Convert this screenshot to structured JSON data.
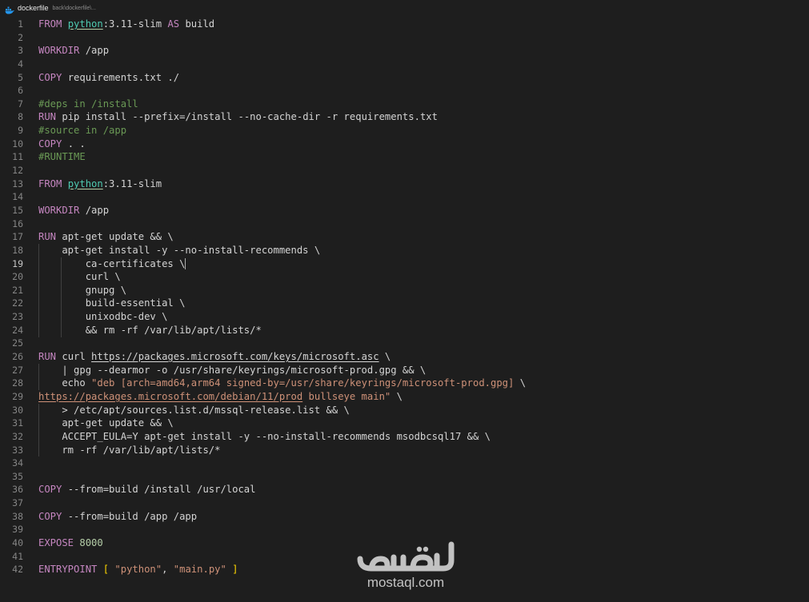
{
  "tab": {
    "title": "dockerfile",
    "path": "back\\dockerfile\\...",
    "icon": "docker-whale-icon"
  },
  "editor": {
    "active_line": 19,
    "lines": [
      {
        "n": "1",
        "tokens": [
          [
            "k",
            "FROM "
          ],
          [
            "img",
            "python"
          ],
          [
            "t",
            ":3.11-slim "
          ],
          [
            "k",
            "AS "
          ],
          [
            "t",
            "build"
          ]
        ]
      },
      {
        "n": "2",
        "tokens": []
      },
      {
        "n": "3",
        "tokens": [
          [
            "k",
            "WORKDIR "
          ],
          [
            "t",
            "/app"
          ]
        ]
      },
      {
        "n": "4",
        "tokens": []
      },
      {
        "n": "5",
        "tokens": [
          [
            "k",
            "COPY "
          ],
          [
            "t",
            "requirements.txt ./"
          ]
        ]
      },
      {
        "n": "6",
        "tokens": []
      },
      {
        "n": "7",
        "tokens": [
          [
            "c",
            "#deps in /install"
          ]
        ]
      },
      {
        "n": "8",
        "tokens": [
          [
            "k",
            "RUN "
          ],
          [
            "t",
            "pip install --prefix=/install --no-cache-dir -r requirements.txt"
          ]
        ]
      },
      {
        "n": "9",
        "tokens": [
          [
            "c",
            "#source in /app"
          ]
        ]
      },
      {
        "n": "10",
        "tokens": [
          [
            "k",
            "COPY "
          ],
          [
            "t",
            ". ."
          ]
        ]
      },
      {
        "n": "11",
        "tokens": [
          [
            "c",
            "#RUNTIME"
          ]
        ]
      },
      {
        "n": "12",
        "tokens": []
      },
      {
        "n": "13",
        "tokens": [
          [
            "k",
            "FROM "
          ],
          [
            "img",
            "python"
          ],
          [
            "t",
            ":3.11-slim"
          ]
        ]
      },
      {
        "n": "14",
        "tokens": []
      },
      {
        "n": "15",
        "tokens": [
          [
            "k",
            "WORKDIR "
          ],
          [
            "t",
            "/app"
          ]
        ]
      },
      {
        "n": "16",
        "tokens": []
      },
      {
        "n": "17",
        "tokens": [
          [
            "k",
            "RUN "
          ],
          [
            "t",
            "apt-get update && \\"
          ]
        ]
      },
      {
        "n": "18",
        "tokens": [
          [
            "t",
            "    apt-get install -y --no-install-recommends \\"
          ]
        ]
      },
      {
        "n": "19",
        "tokens": [
          [
            "t",
            "        ca-certificates \\"
          ]
        ],
        "cursor": true
      },
      {
        "n": "20",
        "tokens": [
          [
            "t",
            "        curl \\"
          ]
        ]
      },
      {
        "n": "21",
        "tokens": [
          [
            "t",
            "        gnupg \\"
          ]
        ]
      },
      {
        "n": "22",
        "tokens": [
          [
            "t",
            "        build-essential \\"
          ]
        ]
      },
      {
        "n": "23",
        "tokens": [
          [
            "t",
            "        unixodbc-dev \\"
          ]
        ]
      },
      {
        "n": "24",
        "tokens": [
          [
            "t",
            "        && rm -rf /var/lib/apt/lists/*"
          ]
        ]
      },
      {
        "n": "25",
        "tokens": []
      },
      {
        "n": "26",
        "tokens": [
          [
            "k",
            "RUN "
          ],
          [
            "t",
            "curl "
          ],
          [
            "url",
            "https://packages.microsoft.com/keys/microsoft.asc"
          ],
          [
            "t",
            " \\"
          ]
        ]
      },
      {
        "n": "27",
        "tokens": [
          [
            "t",
            "    | gpg --dearmor -o /usr/share/keyrings/microsoft-prod.gpg && \\"
          ]
        ]
      },
      {
        "n": "28",
        "tokens": [
          [
            "t",
            "    echo "
          ],
          [
            "s",
            "\"deb [arch=amd64,arm64 signed-by=/usr/share/keyrings/microsoft-prod.gpg]"
          ],
          [
            "t",
            " \\"
          ]
        ]
      },
      {
        "n": "29",
        "tokens": [
          [
            "surl",
            "https://packages.microsoft.com/debian/11/prod"
          ],
          [
            "s",
            " bullseye main\""
          ],
          [
            "t",
            " \\"
          ]
        ]
      },
      {
        "n": "30",
        "tokens": [
          [
            "t",
            "    > /etc/apt/sources.list.d/mssql-release.list && \\"
          ]
        ]
      },
      {
        "n": "31",
        "tokens": [
          [
            "t",
            "    apt-get update && \\"
          ]
        ]
      },
      {
        "n": "32",
        "tokens": [
          [
            "t",
            "    ACCEPT_EULA=Y apt-get install -y --no-install-recommends msodbcsql17 && \\"
          ]
        ]
      },
      {
        "n": "33",
        "tokens": [
          [
            "t",
            "    rm -rf /var/lib/apt/lists/*"
          ]
        ]
      },
      {
        "n": "34",
        "tokens": []
      },
      {
        "n": "35",
        "tokens": []
      },
      {
        "n": "36",
        "tokens": [
          [
            "k",
            "COPY "
          ],
          [
            "t",
            "--from=build /install /usr/local"
          ]
        ]
      },
      {
        "n": "37",
        "tokens": []
      },
      {
        "n": "38",
        "tokens": [
          [
            "k",
            "COPY "
          ],
          [
            "t",
            "--from=build /app /app"
          ]
        ]
      },
      {
        "n": "39",
        "tokens": []
      },
      {
        "n": "40",
        "tokens": [
          [
            "k",
            "EXPOSE "
          ],
          [
            "n",
            "8000"
          ]
        ]
      },
      {
        "n": "41",
        "tokens": []
      },
      {
        "n": "42",
        "tokens": [
          [
            "k",
            "ENTRYPOINT "
          ],
          [
            "b",
            "[ "
          ],
          [
            "s",
            "\"python\""
          ],
          [
            "t",
            ", "
          ],
          [
            "s",
            "\"main.py\""
          ],
          [
            "b",
            " ]"
          ]
        ]
      }
    ]
  },
  "watermark": {
    "logo": "mostaql-logo",
    "text": "mostaql.com"
  }
}
